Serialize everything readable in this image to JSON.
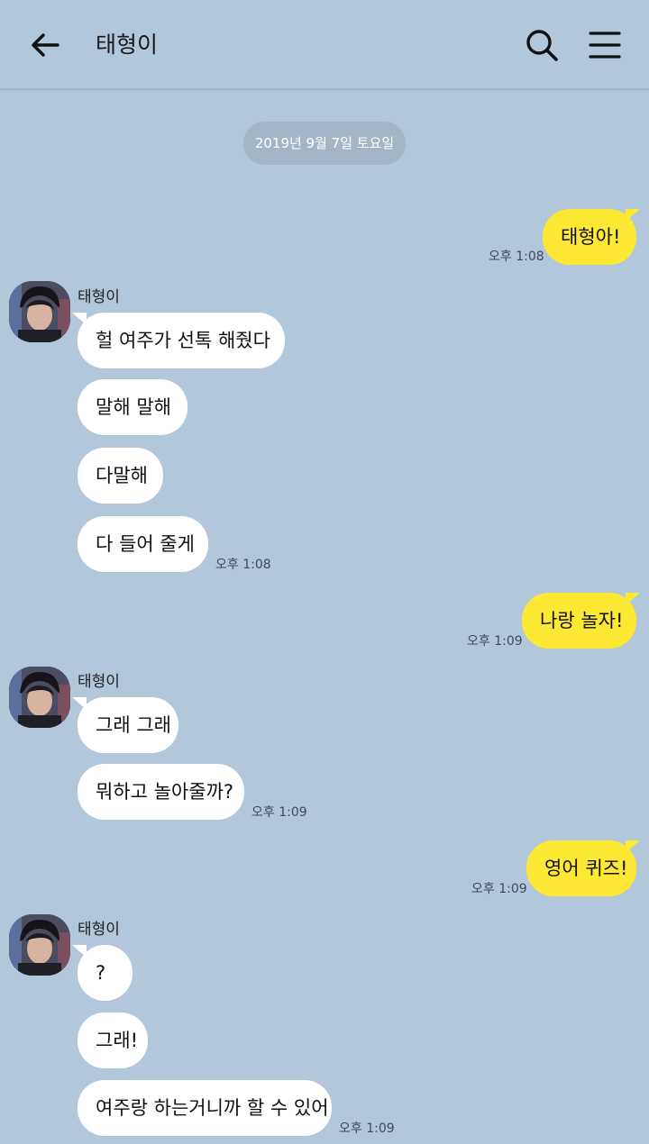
{
  "header": {
    "title": "태형이",
    "back_icon": "arrow-left-icon",
    "search_icon": "search-icon",
    "menu_icon": "menu-icon"
  },
  "date_divider": "2019년 9월 7일 토요일",
  "messages": {
    "m1": {
      "text": "태형아!",
      "time": "오후 1:08"
    },
    "sender1": "태형이",
    "m2": {
      "text": "헐 여주가 선톡 해줬다"
    },
    "m3": {
      "text": "말해 말해"
    },
    "m4": {
      "text": "다말해"
    },
    "m5": {
      "text": "다 들어 줄게",
      "time": "오후 1:08"
    },
    "m6": {
      "text": "나랑 놀자!",
      "time": "오후 1:09"
    },
    "sender2": "태형이",
    "m7": {
      "text": "그래 그래"
    },
    "m8": {
      "text": "뭐하고 놀아줄까?",
      "time": "오후 1:09"
    },
    "m9": {
      "text": "영어 퀴즈!",
      "time": "오후 1:09"
    },
    "sender3": "태형이",
    "m10": {
      "text": "?"
    },
    "m11": {
      "text": "그래!"
    },
    "m12": {
      "text": "여주랑 하는거니까 할 수 있어",
      "time": "오후 1:09"
    }
  },
  "colors": {
    "background": "#b2c7da",
    "outgoing_bubble": "#fde834",
    "incoming_bubble": "#ffffff",
    "date_pill": "#a4b5c6"
  }
}
